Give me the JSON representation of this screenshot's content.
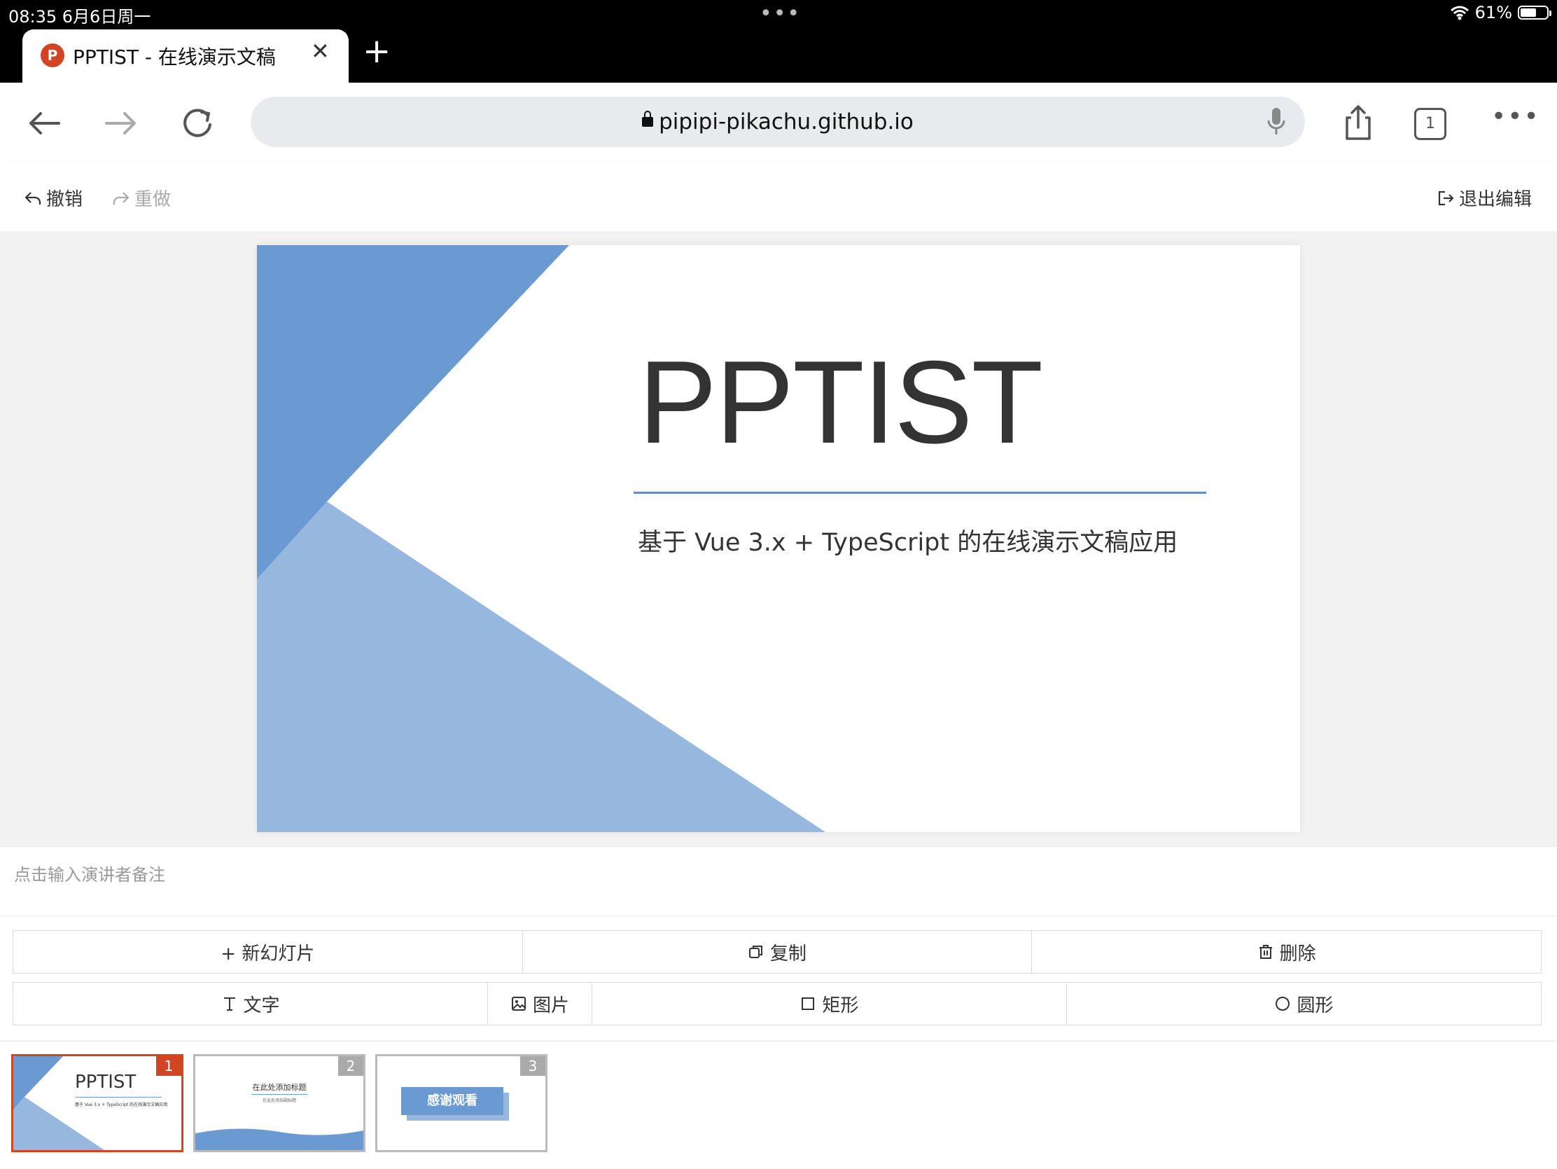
{
  "status_bar": {
    "time": "08:35   6月6日周一",
    "dots": "•••",
    "battery": "61%",
    "battery_level": 0.61
  },
  "browser": {
    "tab_title": "PPTIST - 在线演示文稿",
    "tab_favicon": "P",
    "tab_close": "✕",
    "new_tab": "+",
    "url": "pipipi-pikachu.github.io",
    "tab_count": "1",
    "more": "•••"
  },
  "toolbar": {
    "undo": "撤销",
    "redo": "重做",
    "exit": "退出编辑"
  },
  "slide": {
    "title": "PPTIST",
    "subtitle": "基于 Vue 3.x + TypeScript 的在线演示文稿应用"
  },
  "notes": {
    "placeholder": "点击输入演讲者备注"
  },
  "actions": {
    "new_slide": "+ 新幻灯片",
    "copy": "复制",
    "delete": "删除",
    "text": "文字",
    "image": "图片",
    "rect": "矩形",
    "circle": "圆形"
  },
  "thumbnails": [
    {
      "num": "1",
      "title": "PPTIST",
      "subtitle": "基于 Vue 3.x + TypeScript 的在线演示文稿应用"
    },
    {
      "num": "2",
      "title": "在此处添加标题",
      "subtitle": "在此处添加副标题"
    },
    {
      "num": "3",
      "title": "感谢观看"
    }
  ],
  "colors": {
    "accent": "#d14424",
    "slide_blue_dark": "#6a9ad1",
    "slide_blue_light": "#97b8de"
  }
}
